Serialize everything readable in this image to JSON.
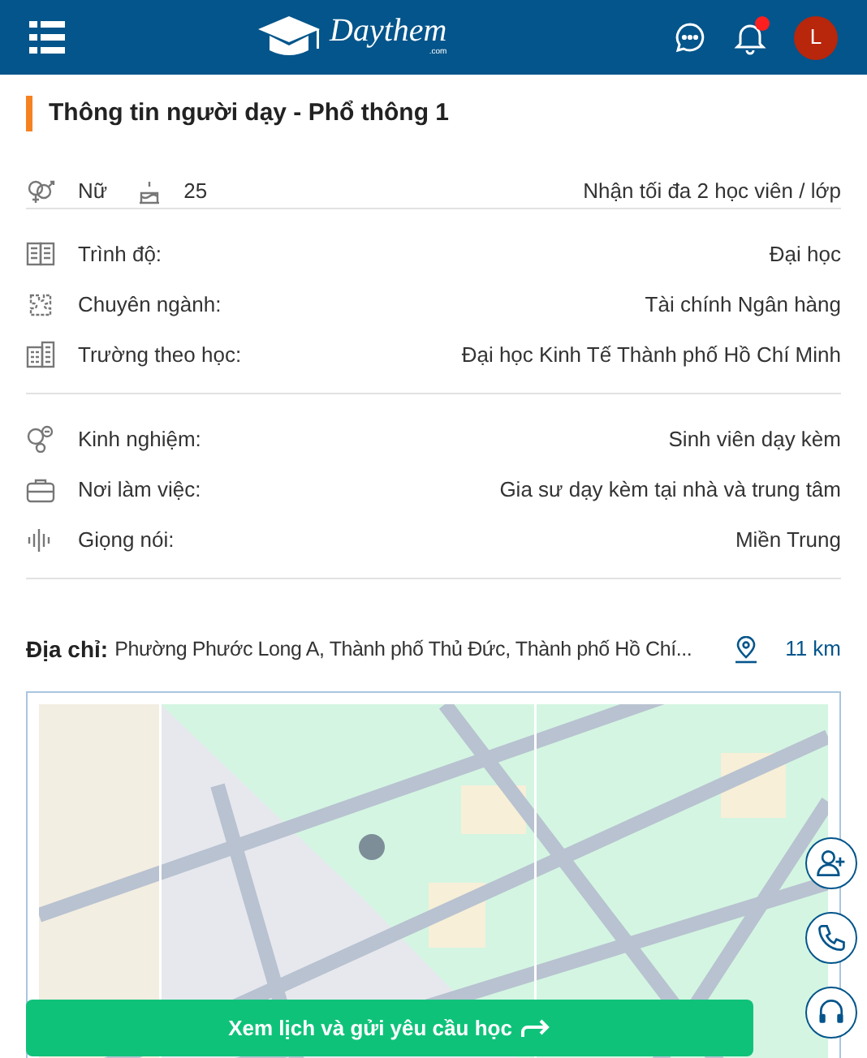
{
  "header": {
    "logo_text": "Daythem",
    "logo_suffix": ".com",
    "notification_unread": true,
    "avatar_letter": "L"
  },
  "section_title": "Thông tin người dạy - Phổ thông 1",
  "summary": {
    "gender": "Nữ",
    "age": "25",
    "capacity": "Nhận tối đa 2 học viên / lớp"
  },
  "groups": [
    [
      {
        "label": "Trình độ:",
        "value": "Đại học"
      },
      {
        "label": "Chuyên ngành:",
        "value": "Tài chính Ngân hàng"
      },
      {
        "label": "Trường theo học:",
        "value": "Đại học Kinh Tế Thành phố Hồ Chí Minh"
      }
    ],
    [
      {
        "label": "Kinh nghiệm:",
        "value": "Sinh viên dạy kèm"
      },
      {
        "label": "Nơi làm việc:",
        "value": "Gia sư dạy kèm tại nhà và trung tâm"
      },
      {
        "label": "Giọng nói:",
        "value": "Miền Trung"
      }
    ]
  ],
  "address": {
    "label": "Địa chỉ:",
    "value": "Phường Phước Long A, Thành phố Thủ Đức, Thành phố Hồ Chí...",
    "distance": "11 km"
  },
  "cta_button": "Xem lịch và gửi yêu cầu học"
}
